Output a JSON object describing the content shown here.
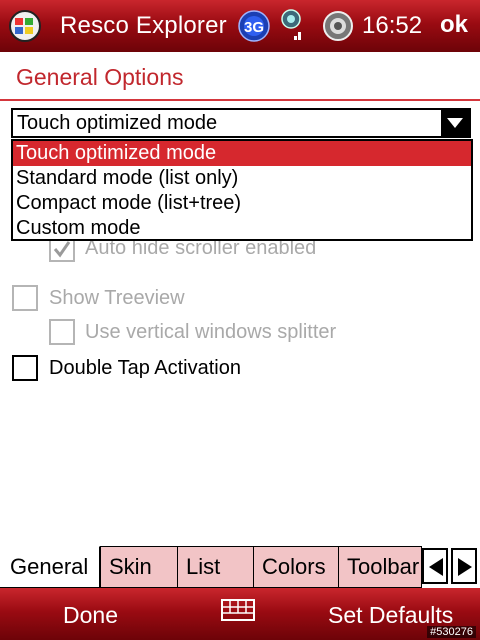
{
  "status_bar": {
    "app_title": "Resco Explorer",
    "network_label": "3G",
    "clock": "16:52",
    "ok_label": "ok",
    "icons": [
      "windows-start-icon",
      "3g-network-icon",
      "signal-strength-icon",
      "volume-icon"
    ]
  },
  "page": {
    "title": "General Options"
  },
  "mode_select": {
    "value": "Touch optimized mode",
    "options": [
      {
        "label": "Touch optimized mode",
        "selected": true
      },
      {
        "label": "Standard mode (list only)",
        "selected": false
      },
      {
        "label": "Compact mode (list+tree)",
        "selected": false
      },
      {
        "label": "Custom mode",
        "selected": false
      }
    ]
  },
  "options": {
    "auto_hide_scroller": {
      "label": "Auto hide scroller enabled",
      "checked": true,
      "enabled": false
    },
    "show_treeview": {
      "label": "Show Treeview",
      "checked": false,
      "enabled": false
    },
    "vertical_splitter": {
      "label": "Use vertical windows splitter",
      "checked": false,
      "enabled": false
    },
    "double_tap": {
      "label": "Double Tap Activation",
      "checked": false,
      "enabled": true
    }
  },
  "tabs": [
    {
      "label": "General",
      "active": true
    },
    {
      "label": "Skin",
      "active": false
    },
    {
      "label": "List",
      "active": false
    },
    {
      "label": "Colors",
      "active": false
    },
    {
      "label": "Toolbar",
      "active": false
    }
  ],
  "softkeys": {
    "left": "Done",
    "right": "Set Defaults"
  },
  "watermark": "#530276",
  "colors": {
    "accent": "#c1272d",
    "bar": "#9a0b12",
    "selection": "#d6282e",
    "inactive_tab": "#f2c4c6"
  }
}
